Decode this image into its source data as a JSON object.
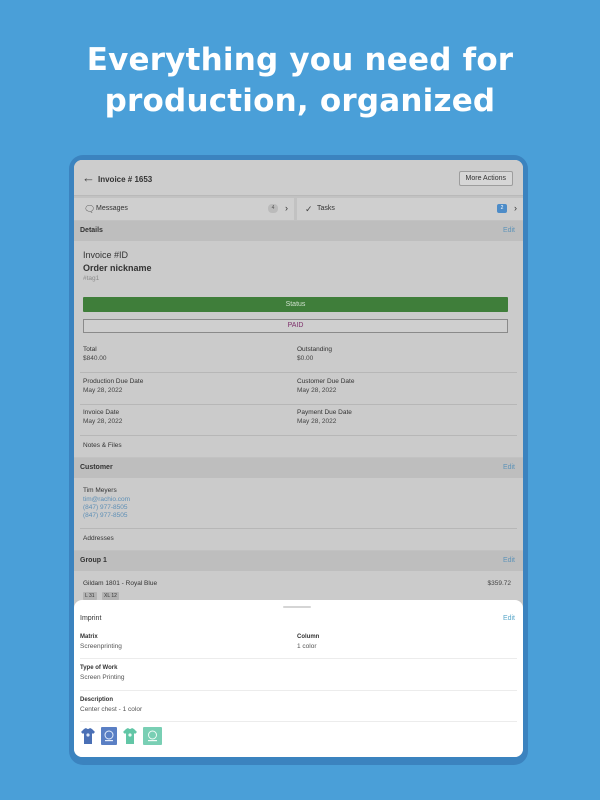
{
  "headline": {
    "line1": "Everything you need for",
    "line2": "production, organized"
  },
  "header": {
    "back_icon": "back-arrow-icon",
    "title": "Invoice # 1653",
    "more_actions": "More Actions"
  },
  "tabs": {
    "messages": {
      "icon": "chat-bubbles-icon",
      "label": "Messages",
      "count": "4"
    },
    "tasks": {
      "icon": "checkmark-icon",
      "label": "Tasks",
      "count": "2"
    }
  },
  "details": {
    "section_title": "Details",
    "edit": "Edit",
    "invoice_id": "Invoice #ID",
    "nickname": "Order nickname",
    "tag": "#tag1",
    "status_label": "Status",
    "status_value": "PAID",
    "fields": [
      {
        "label": "Total",
        "value": "$840.00"
      },
      {
        "label": "Outstanding",
        "value": "$0.00"
      },
      {
        "label": "Production Due Date",
        "value": "May 28, 2022"
      },
      {
        "label": "Customer Due Date",
        "value": "May 28, 2022"
      },
      {
        "label": "Invoice Date",
        "value": "May 28, 2022"
      },
      {
        "label": "Payment Due Date",
        "value": "May 28, 2022"
      }
    ],
    "notes_files": "Notes & Files"
  },
  "customer": {
    "section_title": "Customer",
    "edit": "Edit",
    "name": "Tim Meyers",
    "email": "tim@rachio.com",
    "phone1": "(847) 977-8505",
    "phone2": "(847) 977-8505",
    "addresses": "Addresses"
  },
  "group": {
    "section_title": "Group 1",
    "edit": "Edit",
    "item_name": "Gildam 1801 - Royal Blue",
    "item_price": "$359.72",
    "sizes": [
      "L 31",
      "XL 12"
    ]
  },
  "imprint": {
    "title": "Imprint",
    "edit": "Edit",
    "matrix_label": "Matrix",
    "matrix_value": "Screenprinting",
    "column_label": "Column",
    "column_value": "1 color",
    "type_label": "Type of Work",
    "type_value": "Screen Printing",
    "desc_label": "Description",
    "desc_value": "Center chest - 1 color",
    "thumbnails": [
      {
        "icon": "blue-shirt-mockup-icon",
        "color": "#4a6fb5"
      },
      {
        "icon": "blue-logo-artwork-icon",
        "color": "#5a7fc4"
      },
      {
        "icon": "teal-shirt-mockup-icon",
        "color": "#62c6a6"
      },
      {
        "icon": "teal-logo-artwork-icon",
        "color": "#79cfb4"
      }
    ]
  }
}
